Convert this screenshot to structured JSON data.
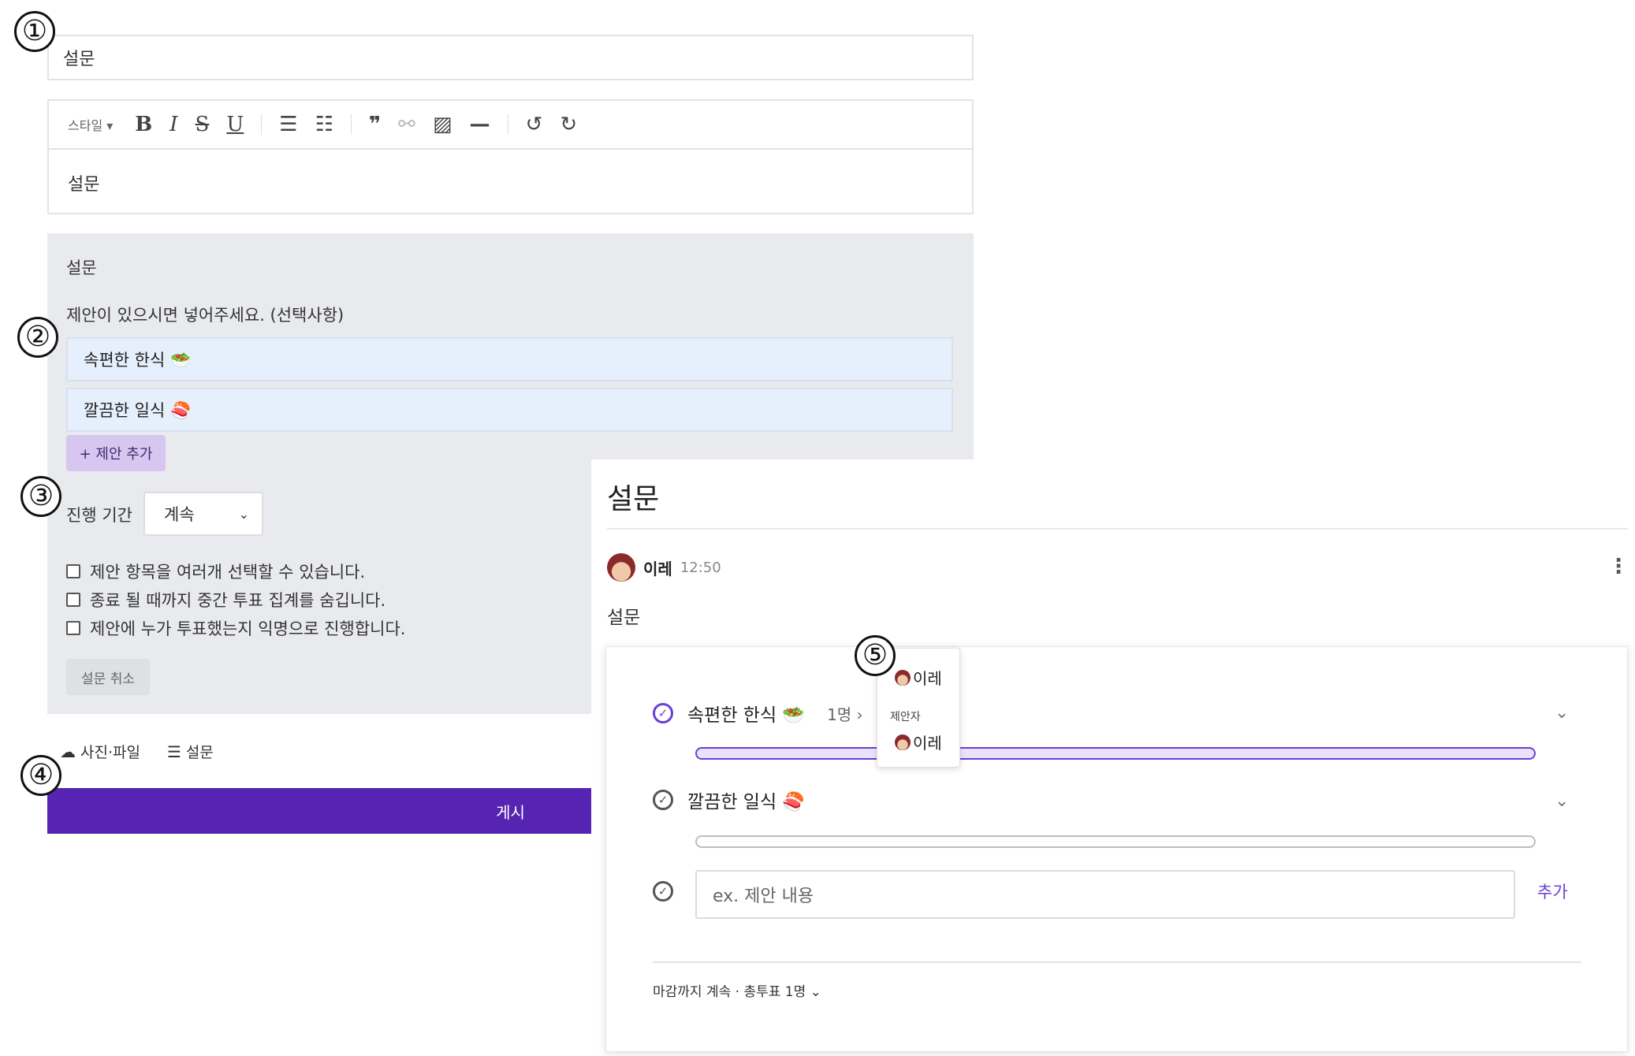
{
  "markers": [
    "①",
    "②",
    "③",
    "④",
    "⑤"
  ],
  "editor": {
    "title_value": "설문",
    "toolbar": {
      "style_label": "스타일 ▾",
      "bold": "B",
      "italic": "I",
      "strike": "S",
      "underline": "U",
      "bullet_list": "☰",
      "ordered_list": "☷",
      "quote": "❞",
      "link": "⚯",
      "image": "▨",
      "hr": "—",
      "undo": "↺",
      "redo": "↻"
    },
    "body_text": "설문"
  },
  "survey_panel": {
    "heading": "설문",
    "hint": "제안이 있으시면 넣어주세요. (선택사항)",
    "options": [
      "속편한 한식 🥗",
      "깔끔한 일식 🍣"
    ],
    "add_option_label": "+ 제안 추가",
    "period_label": "진행 기간",
    "period_value": "계속",
    "checkboxes": [
      "제안 항목을 여러개 선택할 수 있습니다.",
      "종료 될 때까지 중간 투표 집계를 숨깁니다.",
      "제안에 누가 투표했는지 익명으로 진행합니다."
    ],
    "cancel_label": "설문 취소"
  },
  "attachments": {
    "photo_file": "사진·파일",
    "survey": "설문"
  },
  "post_button": "게시",
  "preview": {
    "title": "설문",
    "author": "이레",
    "time": "12:50",
    "more": "⋮",
    "body": "설문",
    "poll": {
      "options": [
        {
          "label": "속편한 한식 🥗",
          "count": "1명",
          "voted": true,
          "fill": 1.0
        },
        {
          "label": "깔끔한 일식 🍣",
          "count": "",
          "voted": false,
          "fill": 0.0
        }
      ],
      "new_option_placeholder": "ex. 제안 내용",
      "add_label": "추가",
      "footer": "마감까지 계속 · 총투표 1명 ⌄"
    },
    "tooltip": {
      "voter": "이레",
      "proposer_label": "제안자",
      "proposer": "이레"
    }
  }
}
